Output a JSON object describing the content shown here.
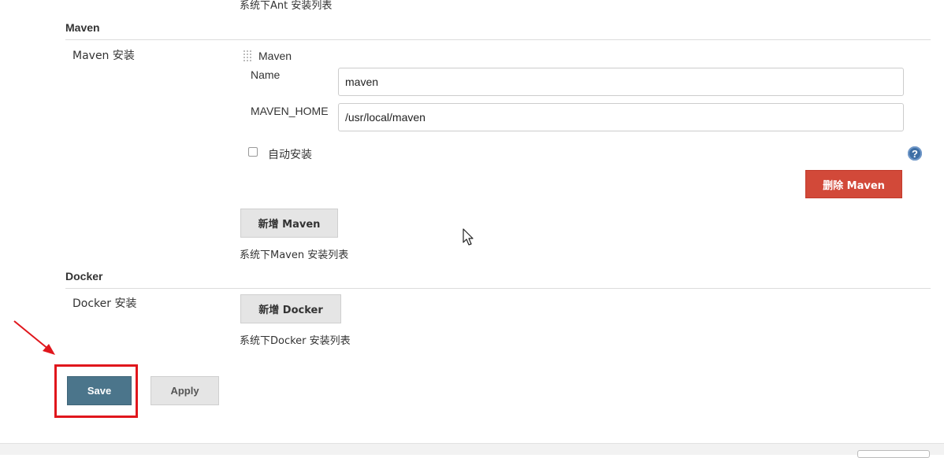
{
  "ant": {
    "list_desc": "系统下Ant 安装列表"
  },
  "maven": {
    "section_title": "Maven",
    "row_label": "Maven 安装",
    "item_header": "Maven",
    "name_label": "Name",
    "name_value": "maven",
    "home_label": "MAVEN_HOME",
    "home_value": "/usr/local/maven",
    "auto_install_label": "自动安装",
    "help_symbol": "?",
    "delete_button": "删除 Maven",
    "add_button": "新增 Maven",
    "list_desc": "系统下Maven 安装列表"
  },
  "docker": {
    "section_title": "Docker",
    "row_label": "Docker 安装",
    "add_button": "新增 Docker",
    "list_desc": "系统下Docker 安装列表"
  },
  "actions": {
    "save_label": "Save",
    "apply_label": "Apply"
  },
  "colors": {
    "save_bg": "#4b758b",
    "delete_bg": "#d24939",
    "annotation_red": "#e0161c",
    "help_blue": "#3d6ea5"
  }
}
